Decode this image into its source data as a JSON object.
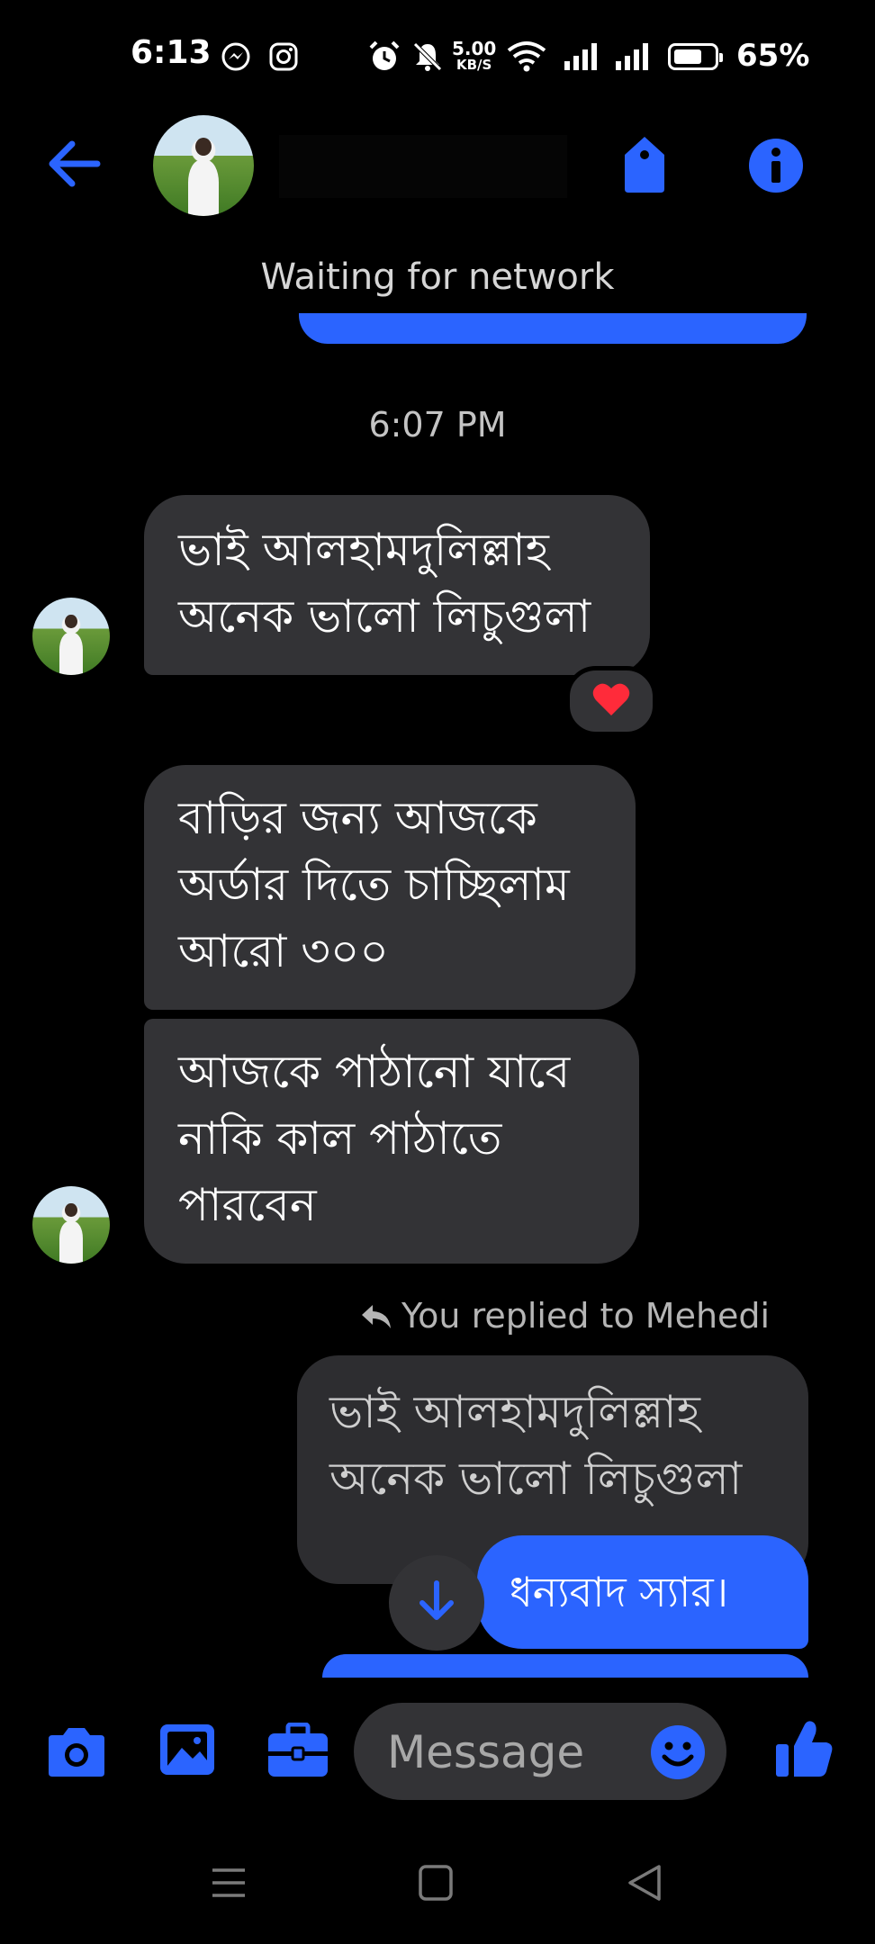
{
  "status_bar": {
    "time": "6:13",
    "net_speed_value": "5.00",
    "net_speed_unit": "KB/S",
    "battery_percent": "65%",
    "battery_level": 0.65
  },
  "header": {
    "connection_status": "Waiting for network"
  },
  "conversation": {
    "timestamp": "6:07 PM",
    "messages": [
      {
        "lines": [
          "ভাই আলহামদুলিল্লাহ",
          "অনেক ভালো লিচুগুলা"
        ],
        "reaction": "❤"
      },
      {
        "lines": [
          "বাড়ির জন্য আজকে",
          "অর্ডার দিতে চাচ্ছিলাম",
          "আরো ৩০০"
        ]
      },
      {
        "lines": [
          "আজকে পাঠানো যাবে",
          "নাকি কাল পাঠাতে",
          "পারবেন"
        ]
      }
    ],
    "replied_label": "You replied to Mehedi",
    "quoted_lines": [
      "ভাই আলহামদুলিল্লাহ",
      "অনেক ভালো লিচুগুলা"
    ],
    "reply_text": "ধন্যবাদ স্যার।"
  },
  "composer": {
    "placeholder": "Message"
  },
  "colors": {
    "accent": "#2b64ff",
    "incoming_bubble": "#333336",
    "background": "#000000"
  },
  "icons": [
    "messenger-icon",
    "instagram-icon",
    "alarm-icon",
    "mute-icon",
    "wifi-icon",
    "signal-icon",
    "back-arrow-icon",
    "tag-icon",
    "info-icon",
    "camera-icon",
    "gallery-icon",
    "briefcase-icon",
    "emoji-icon",
    "thumbs-up-icon",
    "scroll-down-icon",
    "reply-arrow-icon",
    "heart-icon",
    "menu-icon",
    "home-icon",
    "back-icon"
  ]
}
